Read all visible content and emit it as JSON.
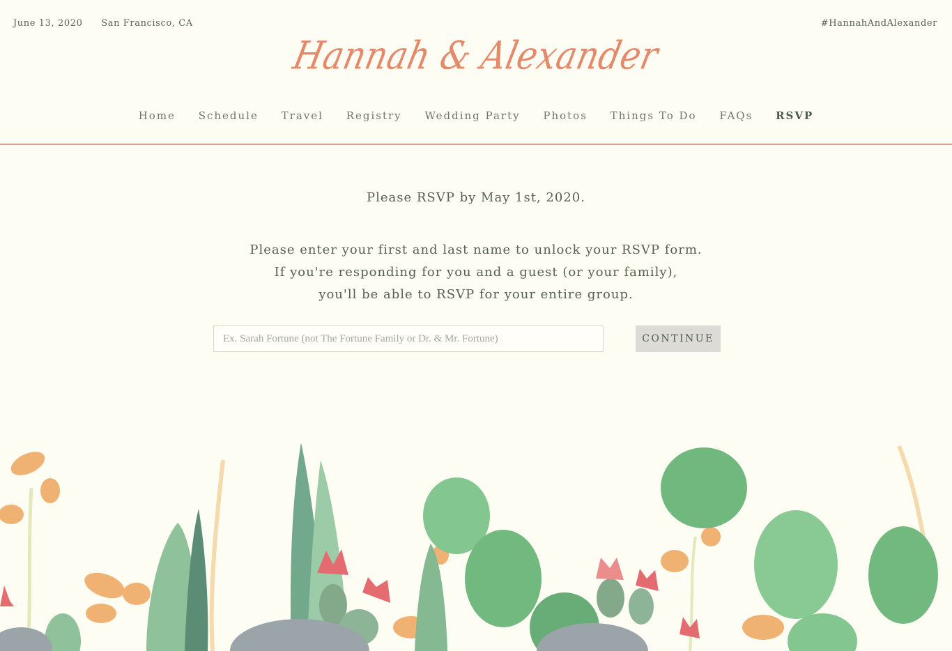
{
  "header": {
    "date": "June 13, 2020",
    "location": "San Francisco, CA",
    "hashtag": "#HannahAndAlexander",
    "logo": "Hannah & Alexander"
  },
  "nav": {
    "items": [
      "Home",
      "Schedule",
      "Travel",
      "Registry",
      "Wedding Party",
      "Photos",
      "Things To Do",
      "FAQs",
      "RSVP"
    ],
    "active": "RSVP"
  },
  "rsvp": {
    "deadline": "Please RSVP by May 1st, 2020.",
    "instructions": [
      "Please enter your first and last name to unlock your RSVP form.",
      "If you're responding for you and a guest (or your family),",
      "you'll be able to RSVP for your entire group."
    ],
    "name_placeholder": "Ex. Sarah Fortune (not The Fortune Family or Dr. & Mr. Fortune)",
    "name_value": "",
    "continue_label": "CONTINUE"
  },
  "theme": {
    "background": "#fefdf3",
    "accent": "#e48a6a",
    "text": "#56624f",
    "button_bg": "#dcdbd6"
  },
  "decoration": {
    "icons": [
      "cactus-illustration",
      "flower-illustration",
      "rock-illustration"
    ]
  }
}
